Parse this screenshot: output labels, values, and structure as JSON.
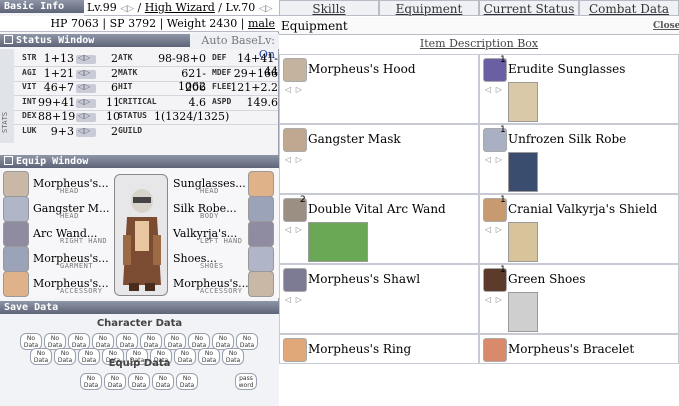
{
  "basic": {
    "header": "Basic Info",
    "lv_label": "Lv.",
    "base_level": "99",
    "job_class": "High Wizard",
    "job_level": "70",
    "hp_label": "HP",
    "hp": "7063",
    "sp_label": "SP",
    "sp": "3792",
    "weight_label": "Weight",
    "weight": "2430",
    "gender": "male"
  },
  "status_window": {
    "header": "Status Window",
    "auto_label": "Auto BaseLv:",
    "auto_state": "On",
    "side_label": "STATS",
    "rows": [
      {
        "stat": "STR",
        "val": "1+13",
        "pt": "2",
        "l2": "ATK",
        "v2": "98-98+0",
        "l3": "DEF",
        "v3": "14+41-44"
      },
      {
        "stat": "AGI",
        "val": "1+21",
        "pt": "2",
        "l2": "MATK",
        "v2": "621-1062",
        "l3": "MDEF",
        "v3": "29+166"
      },
      {
        "stat": "VIT",
        "val": "46+7",
        "pt": "6",
        "l2": "HIT",
        "v2": "206",
        "l3": "FLEE",
        "v3": "121+2.2"
      },
      {
        "stat": "INT",
        "val": "99+41",
        "pt": "11",
        "l2": "CRITICAL",
        "v2": "4.6",
        "l3": "ASPD",
        "v3": "149.6"
      },
      {
        "stat": "DEX",
        "val": "88+19",
        "pt": "10",
        "l2": "STATUS",
        "v2": "1(1324/1325)",
        "l3": "",
        "v3": ""
      },
      {
        "stat": "LUK",
        "val": "9+3",
        "pt": "2",
        "l2": "GUILD",
        "v2": "",
        "l3": "",
        "v3": ""
      }
    ]
  },
  "equip_window": {
    "header": "Equip Window",
    "left_items": [
      {
        "name": "Morpheus's...",
        "slot": "HEAD"
      },
      {
        "name": "Gangster M...",
        "slot": "HEAD"
      },
      {
        "name": "Arc Wand...",
        "slot": "RIGHT HAND"
      },
      {
        "name": "Morpheus's...",
        "slot": "GARMENT"
      },
      {
        "name": "Morpheus's...",
        "slot": "ACCESSORY"
      }
    ],
    "right_items": [
      {
        "name": "Sunglasses...",
        "slot": "HEAD"
      },
      {
        "name": "Silk Robe...",
        "slot": "BODY"
      },
      {
        "name": "Valkyrja's...",
        "slot": "LEFT HAND"
      },
      {
        "name": "Shoes...",
        "slot": "SHOES"
      },
      {
        "name": "Morpheus's...",
        "slot": "ACCESSORY"
      }
    ]
  },
  "save_data": {
    "header": "Save Data",
    "character_title": "Character Data",
    "equip_title": "Equip Data",
    "slot_label_1": "No",
    "slot_label_2": "Data",
    "password_1": "pass",
    "password_2": "word"
  },
  "tabs": [
    "Skills",
    "Equipment",
    "Current Status",
    "Combat Data"
  ],
  "panel": {
    "title": "Equipment",
    "close": "Close",
    "desc_link": "Item Description Box",
    "slot_marks": "◁ ▷"
  },
  "equipment": [
    {
      "name": "Morpheus's Hood",
      "badge": ""
    },
    {
      "name": "Erudite Sunglasses",
      "badge": "1"
    },
    {
      "name": "Gangster Mask",
      "badge": ""
    },
    {
      "name": "Unfrozen Silk Robe",
      "badge": "1"
    },
    {
      "name": "Double Vital Arc Wand",
      "badge": "2"
    },
    {
      "name": "Cranial Valkyrja's Shield",
      "badge": "1"
    },
    {
      "name": "Morpheus's Shawl",
      "badge": ""
    },
    {
      "name": "Green Shoes",
      "badge": "1"
    },
    {
      "name": "Morpheus's Ring",
      "badge": ""
    },
    {
      "name": "Morpheus's Bracelet",
      "badge": ""
    }
  ],
  "colors": {
    "bar": "#5d6477",
    "accent": "#1a3fa6",
    "grid": "#c8cad3"
  }
}
